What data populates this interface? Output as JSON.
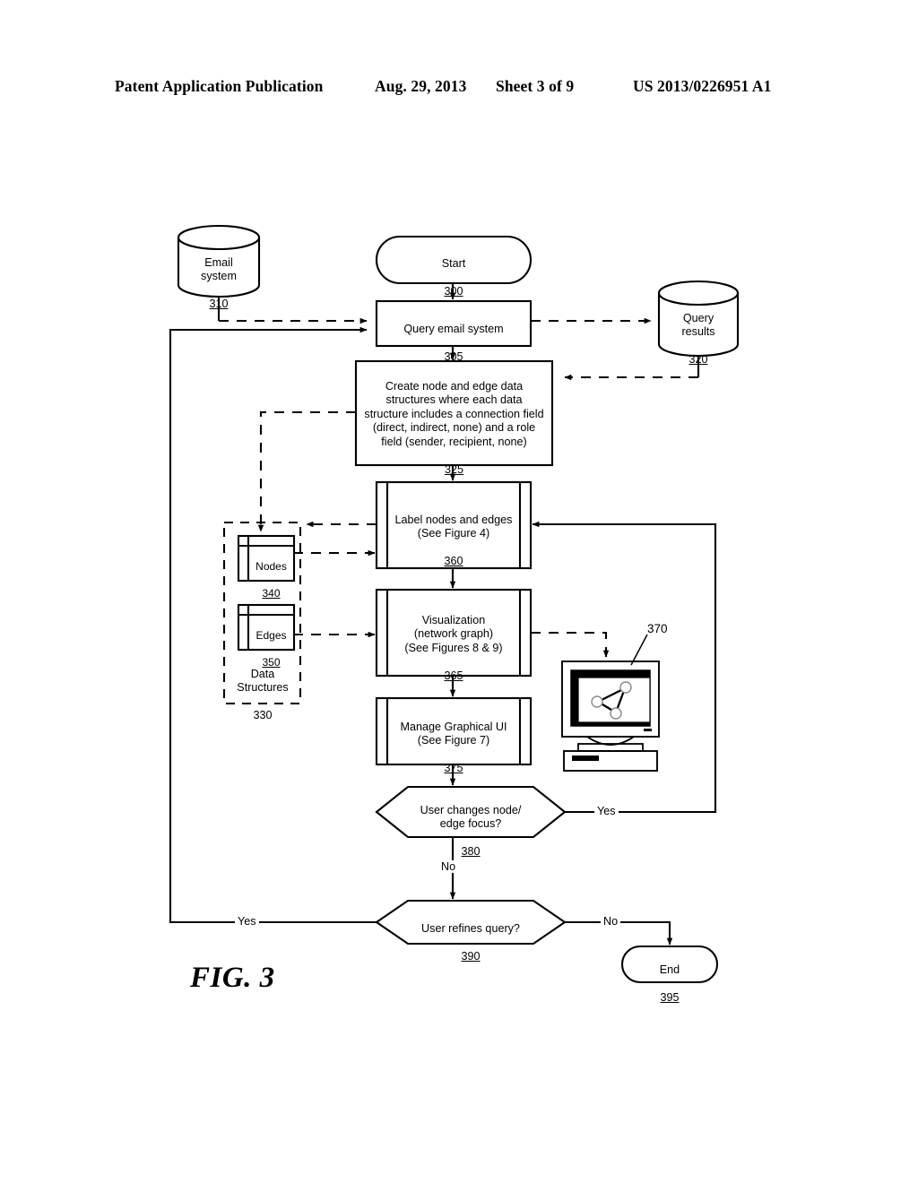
{
  "header": {
    "publication": "Patent Application Publication",
    "date": "Aug. 29, 2013",
    "sheet": "Sheet 3 of 9",
    "patent_number": "US 2013/0226951 A1"
  },
  "figure": {
    "caption": "FIG. 3",
    "title": "Email system network graph generation flowchart"
  },
  "nodes": {
    "email_system": {
      "label": "Email\nsystem",
      "ref": "310",
      "shape": "cylinder"
    },
    "start": {
      "label": "Start",
      "ref": "300",
      "shape": "terminator"
    },
    "query_email": {
      "label": "Query email system",
      "ref": "305",
      "shape": "process"
    },
    "query_results": {
      "label": "Query\nresults",
      "ref": "320",
      "shape": "cylinder"
    },
    "create_structs": {
      "label": "Create node and edge data\nstructures where each data\nstructure includes a connection field\n(direct, indirect, none) and a role\nfield (sender, recipient, none)",
      "ref": "325",
      "shape": "process"
    },
    "label_nodes": {
      "label": "Label nodes and edges\n(See Figure 4)",
      "ref": "360",
      "shape": "predefined-process"
    },
    "visualization": {
      "label": "Visualization\n(network graph)\n(See Figures 8 & 9)",
      "ref": "365",
      "shape": "predefined-process"
    },
    "manage_ui": {
      "label": "Manage Graphical UI\n(See Figure 7)",
      "ref": "375",
      "shape": "predefined-process"
    },
    "decision_focus": {
      "label": "User changes node/\nedge focus?",
      "ref": "380",
      "shape": "decision"
    },
    "decision_refine": {
      "label": "User refines query?",
      "ref": "390",
      "shape": "decision"
    },
    "end": {
      "label": "End",
      "ref": "395",
      "shape": "terminator"
    },
    "nodes_store": {
      "label": "Nodes",
      "ref": "340",
      "shape": "stored-data"
    },
    "edges_store": {
      "label": "Edges",
      "ref": "350",
      "shape": "stored-data"
    },
    "data_structures_group": {
      "label": "Data\nStructures",
      "ref": "330",
      "shape": "dashed-group"
    },
    "monitor": {
      "ref": "370",
      "shape": "computer-monitor"
    }
  },
  "edge_labels": {
    "focus_yes": "Yes",
    "focus_no": "No",
    "refine_yes": "Yes",
    "refine_no": "No"
  }
}
